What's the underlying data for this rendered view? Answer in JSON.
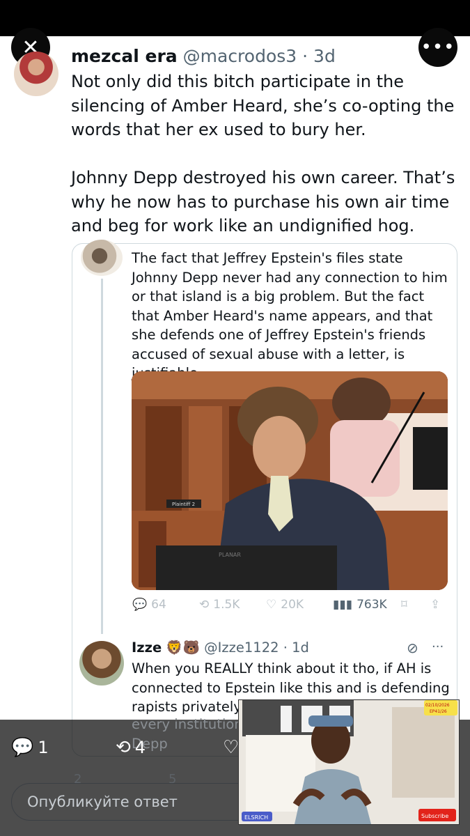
{
  "post": {
    "display_name": "mezcal era",
    "handle": "@macrodos3",
    "time": "· 3d",
    "text": "Not only did this bitch participate in the silencing of Amber Heard, she’s co-opting the words that her ex used to bury her.\n\nJohnny Depp destroyed his own career. That’s why he now has to purchase his own air time and beg for work like an undignified hog."
  },
  "quoted": {
    "text": "The fact that Jeffrey Epstein's files state Johnny Depp never had any connection to him or that island is a big problem. But the fact that Amber Heard's name appears, and that she defends one of Jeffrey Epstein's friends accused of sexual abuse with a letter, is justifiable...",
    "photo_label": "Plaintiff 2",
    "monitor_label": "PLANAR",
    "replies": "64",
    "reposts": "1.5K",
    "likes": "20K",
    "views": "763K"
  },
  "reply": {
    "display_name": "Izze",
    "emojis": "🦁🐻",
    "handle": "@Izze1122",
    "time": "· 1d",
    "text": "When you REALLY think about it tho, if AH is connected to Epstein like this and is defending rapists privately",
    "text_cut_1": "every institution",
    "text_cut_2": "Depp"
  },
  "bottom_bar": {
    "replies": "1",
    "reposts": "4",
    "replies_faded": "2",
    "reposts_faded": "5",
    "reply_placeholder": "Опубликуйте ответ"
  },
  "video": {
    "date_badge": "02/10/2026",
    "episode_badge": "EP41/26",
    "channel_label": "ELSRICH",
    "subscribe_label": "Subscribe"
  },
  "icons": [
    "close-icon",
    "more-icon",
    "reply-icon",
    "repost-icon",
    "like-icon",
    "views-icon",
    "bookmark-icon",
    "share-icon",
    "grok-icon"
  ]
}
